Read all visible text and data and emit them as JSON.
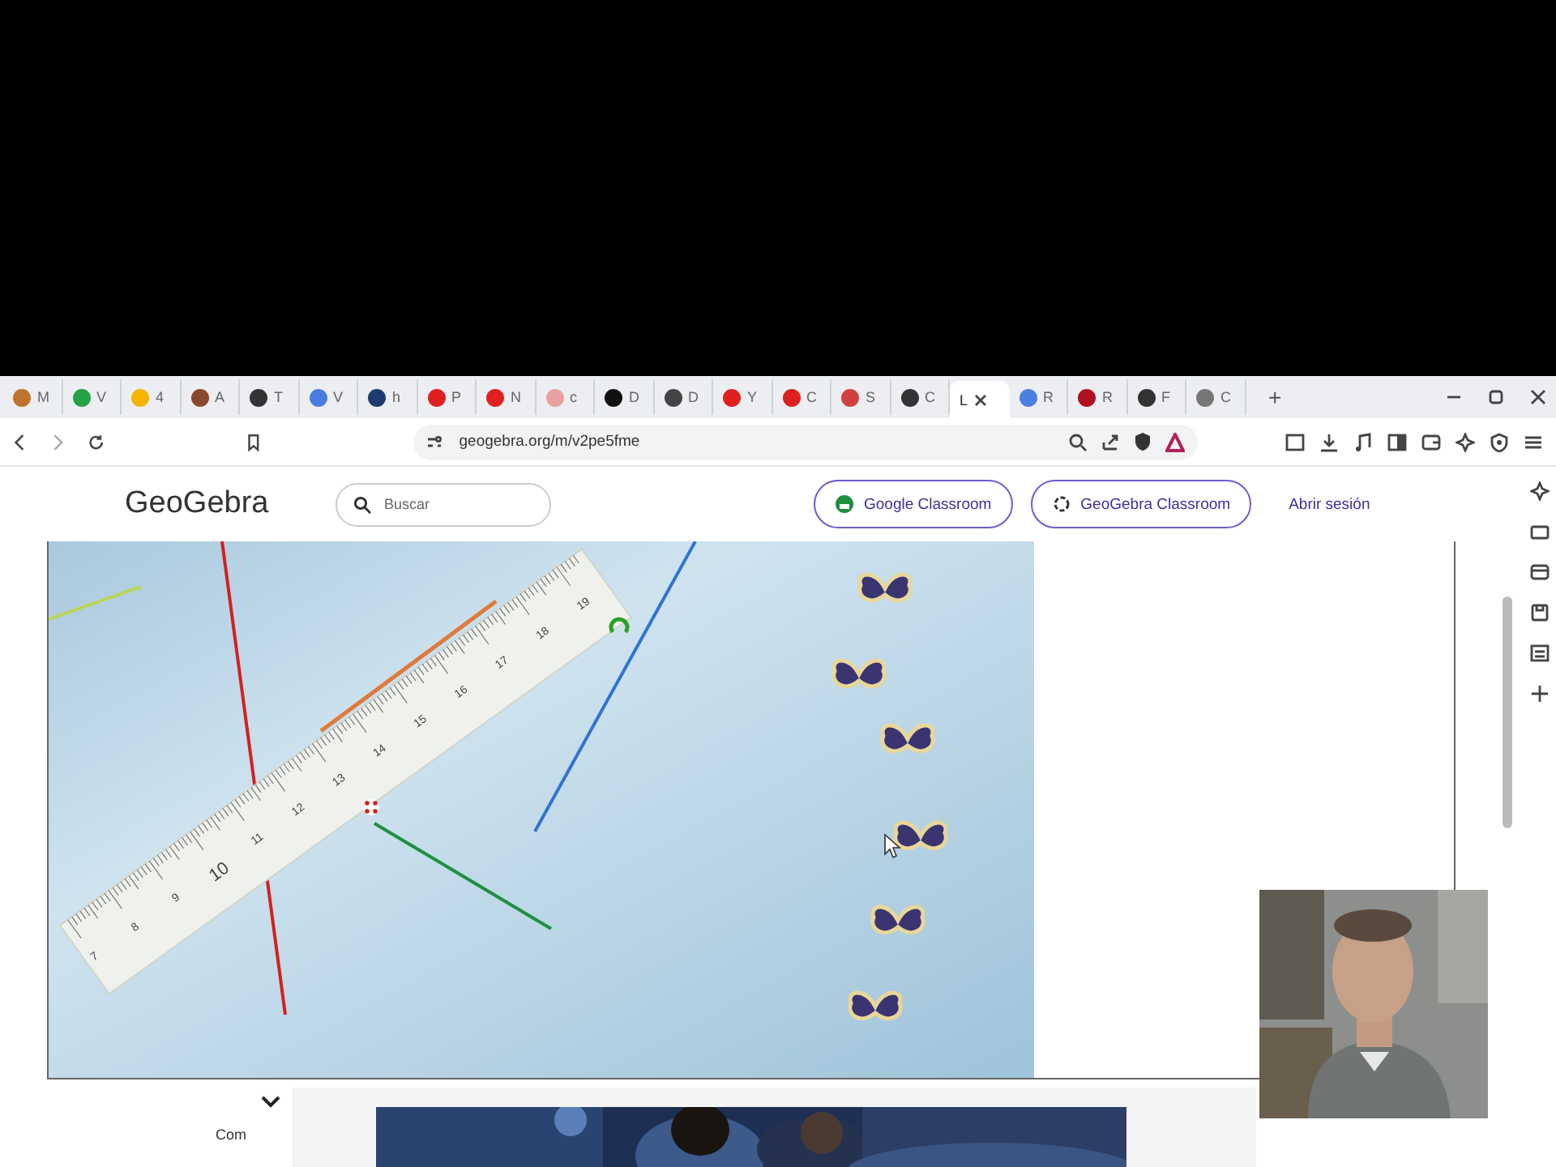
{
  "browser": {
    "tabs": [
      {
        "title": "M",
        "color": "#c0732a",
        "selected": false
      },
      {
        "title": "V",
        "color": "#25a244",
        "selected": false
      },
      {
        "title": "4",
        "color": "#f4b400",
        "selected": false
      },
      {
        "title": "A",
        "color": "#8a4a2a",
        "selected": false
      },
      {
        "title": "T",
        "color": "#333333",
        "selected": false
      },
      {
        "title": "V",
        "color": "#4a7be0",
        "selected": false
      },
      {
        "title": "h",
        "color": "#1d3b70",
        "selected": false
      },
      {
        "title": "P",
        "color": "#e02020",
        "selected": false
      },
      {
        "title": "N",
        "color": "#e02020",
        "selected": false
      },
      {
        "title": "c",
        "color": "#e8a0a0",
        "selected": false
      },
      {
        "title": "D",
        "color": "#111111",
        "selected": false
      },
      {
        "title": "D",
        "color": "#444444",
        "selected": false
      },
      {
        "title": "Y",
        "color": "#e02020",
        "selected": false
      },
      {
        "title": "C",
        "color": "#e02020",
        "selected": false
      },
      {
        "title": "S",
        "color": "#d04040",
        "selected": false
      },
      {
        "title": "C",
        "color": "#333333",
        "selected": false
      },
      {
        "title": "L",
        "selected": true
      },
      {
        "title": "R",
        "color": "#4a80e0",
        "selected": false
      },
      {
        "title": "R",
        "color": "#b01020",
        "selected": false
      },
      {
        "title": "F",
        "color": "#333333",
        "selected": false
      },
      {
        "title": "C",
        "color": "#777777",
        "selected": false
      }
    ],
    "new_tab": "+",
    "address": "geogebra.org/m/v2pe5fme"
  },
  "site": {
    "logo": "GeoGebra",
    "search": {
      "placeholder": "Buscar"
    },
    "buttons": [
      "Google Classroom",
      "GeoGebra Classroom"
    ],
    "sign_in": "Abrir sesión"
  },
  "applet": {
    "ruler_labels": [
      "7",
      "8",
      "9",
      "10",
      "11",
      "12",
      "13",
      "14",
      "15",
      "16",
      "17",
      "18",
      "19"
    ]
  },
  "footer": {
    "text": "Com"
  }
}
